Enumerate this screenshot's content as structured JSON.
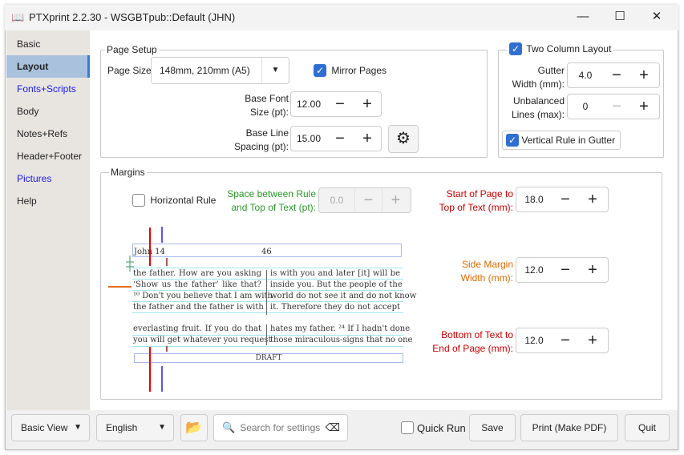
{
  "window": {
    "title": "PTXprint 2.2.30  -  WSGBTpub::Default  (JHN)",
    "minimize": "—",
    "maximize": "☐",
    "close": "✕"
  },
  "sidebar": {
    "items": [
      {
        "label": "Basic"
      },
      {
        "label": "Layout"
      },
      {
        "label": "Fonts+Scripts"
      },
      {
        "label": "Body"
      },
      {
        "label": "Notes+Refs"
      },
      {
        "label": "Header+Footer"
      },
      {
        "label": "Pictures"
      },
      {
        "label": "Help"
      }
    ]
  },
  "page_setup": {
    "legend": "Page Setup",
    "page_size_label": "Page Size:",
    "page_size_value": "148mm, 210mm (A5)",
    "mirror_pages": "Mirror Pages",
    "mirror_checked": true,
    "base_font_label1": "Base Font",
    "base_font_label2": "Size (pt):",
    "base_font_value": "12.00",
    "line_spacing_label1": "Base Line",
    "line_spacing_label2": "Spacing (pt):",
    "line_spacing_value": "15.00"
  },
  "two_column": {
    "label": "Two Column Layout",
    "checked": true,
    "gutter_label1": "Gutter",
    "gutter_label2": "Width (mm):",
    "gutter_value": "4.0",
    "unbalanced_label1": "Unbalanced",
    "unbalanced_label2": "Lines (max):",
    "unbalanced_value": "0",
    "vertical_rule": "Vertical Rule in Gutter",
    "vertical_rule_checked": true
  },
  "margins": {
    "legend": "Margins",
    "horizontal_rule": "Horizontal Rule",
    "space_label1": "Space between Rule",
    "space_label2": "and Top of Text (pt):",
    "space_value": "0.0",
    "start_label1": "Start of Page to",
    "start_label2": "Top of Text (mm):",
    "start_value": "18.0",
    "side_label1": "Side Margin",
    "side_label2": "Width (mm):",
    "side_value": "12.0",
    "bottom_label1": "Bottom of Text to",
    "bottom_label2": "End of Page (mm):",
    "bottom_value": "12.0"
  },
  "preview": {
    "header_left": "John 14",
    "header_page": "46",
    "footer": "DRAFT",
    "col1": [
      "the father. How are you asking",
      "‘Show us the father’ like that?",
      "¹⁰ Don't you believe that I am with",
      "the father and the father is with"
    ],
    "col2": [
      "is with you and later [it] will be",
      "inside you. But the people of the",
      "world do not see it and do not know",
      "it. Therefore they do not accept"
    ],
    "col1b": [
      "everlasting fruit. If you do that",
      "you will get whatever you request"
    ],
    "col2b": [
      "hates my father. ²⁴ If I hadn't done",
      "those miraculous-signs that no one"
    ]
  },
  "bottom": {
    "view": "Basic View",
    "language": "English",
    "search_placeholder": "Search for settings",
    "quick_run": "Quick Run",
    "save": "Save",
    "print": "Print (Make PDF)",
    "quit": "Quit"
  },
  "colors": {
    "accent": "#2f6fd0",
    "green_label": "#2a9a2a",
    "red_label": "#cc0000",
    "orange_label": "#dd6a00",
    "link_blue": "#1a1aee"
  }
}
